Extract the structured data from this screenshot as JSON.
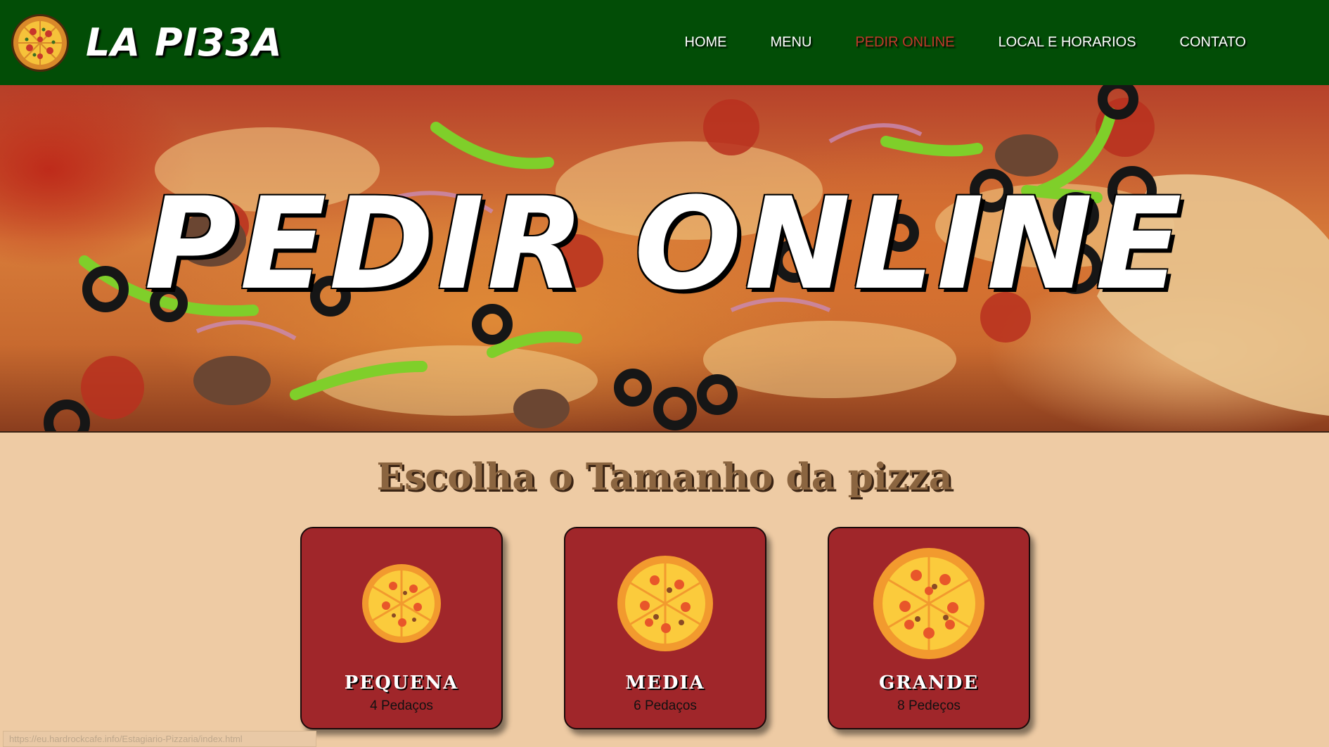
{
  "header": {
    "brand": "LA PI33A",
    "logo_icon": "pizza-logo-icon",
    "nav": [
      {
        "label": "HOME",
        "active": false
      },
      {
        "label": "MENU",
        "active": false
      },
      {
        "label": "PEDIR ONLINE",
        "active": true
      },
      {
        "label": "LOCAL E HORARIOS",
        "active": false
      },
      {
        "label": "CONTATO",
        "active": false
      }
    ]
  },
  "hero": {
    "title": "PEDIR ONLINE",
    "image": "pizza-photo"
  },
  "section": {
    "title": "Escolha o Tamanho da pizza",
    "cards": [
      {
        "name": "PEQUENA",
        "slices": "4 Pedaços",
        "icon": "pizza-small-icon"
      },
      {
        "name": "MEDIA",
        "slices": "6 Pedaços",
        "icon": "pizza-medium-icon"
      },
      {
        "name": "GRANDE",
        "slices": "8 Pedeços",
        "icon": "pizza-large-icon"
      }
    ]
  },
  "colors": {
    "header_bg": "#024d06",
    "nav_active": "#c0392b",
    "page_bg": "#eecba4",
    "card_bg": "#a0262a",
    "title_color": "#8b6540"
  },
  "status_bar": "https://eu.hardrockcafe.info/Estagiario-Pizzaria/index.html"
}
